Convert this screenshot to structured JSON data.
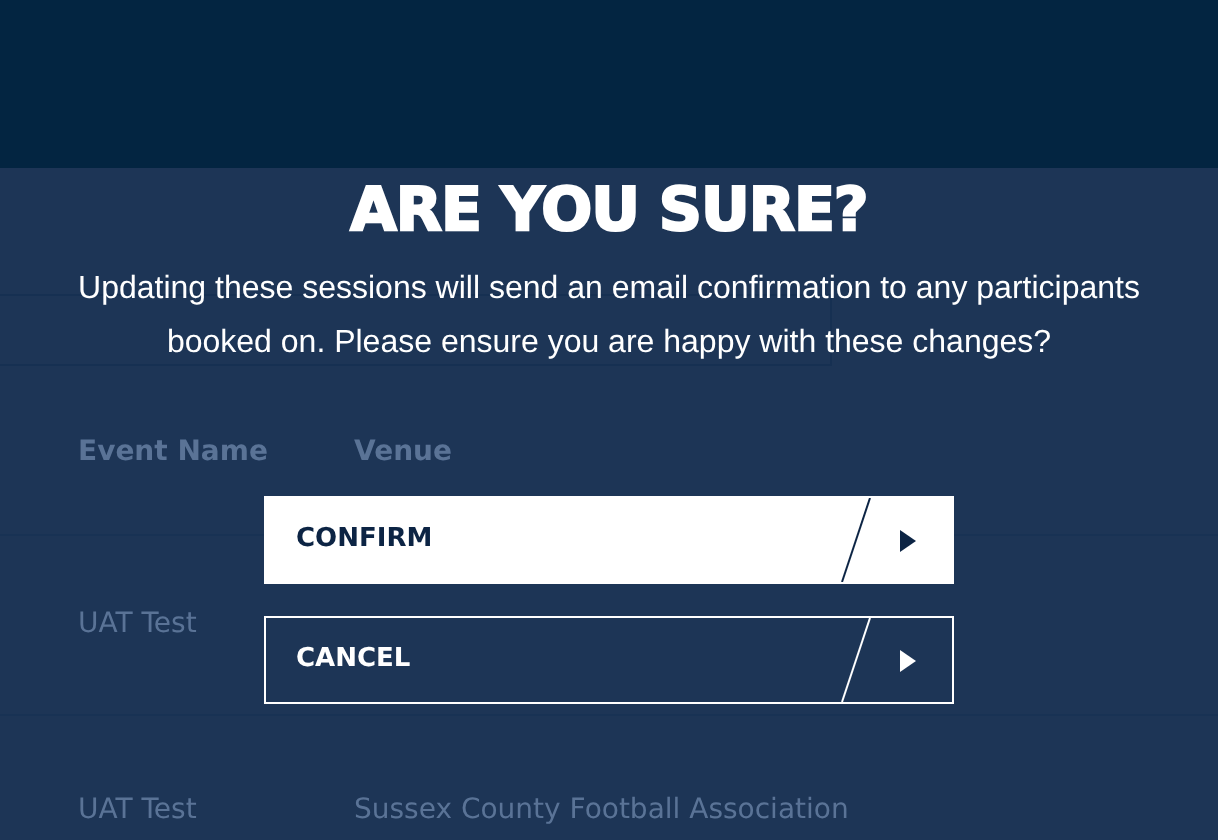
{
  "page": {
    "table": {
      "columns": [
        "Event Name",
        "Venue"
      ],
      "rows": [
        [
          "UAT Test"
        ],
        [
          "UAT Test",
          "Sussex County Football Association"
        ]
      ]
    }
  },
  "dialog": {
    "title": "ARE YOU SURE?",
    "message": "Updating these sessions will send an email confirmation to any participants booked on. Please ensure you are happy with these changes?",
    "buttons": [
      {
        "label": "CONFIRM",
        "kind": "primary"
      },
      {
        "label": "CANCEL",
        "kind": "outline"
      }
    ]
  }
}
